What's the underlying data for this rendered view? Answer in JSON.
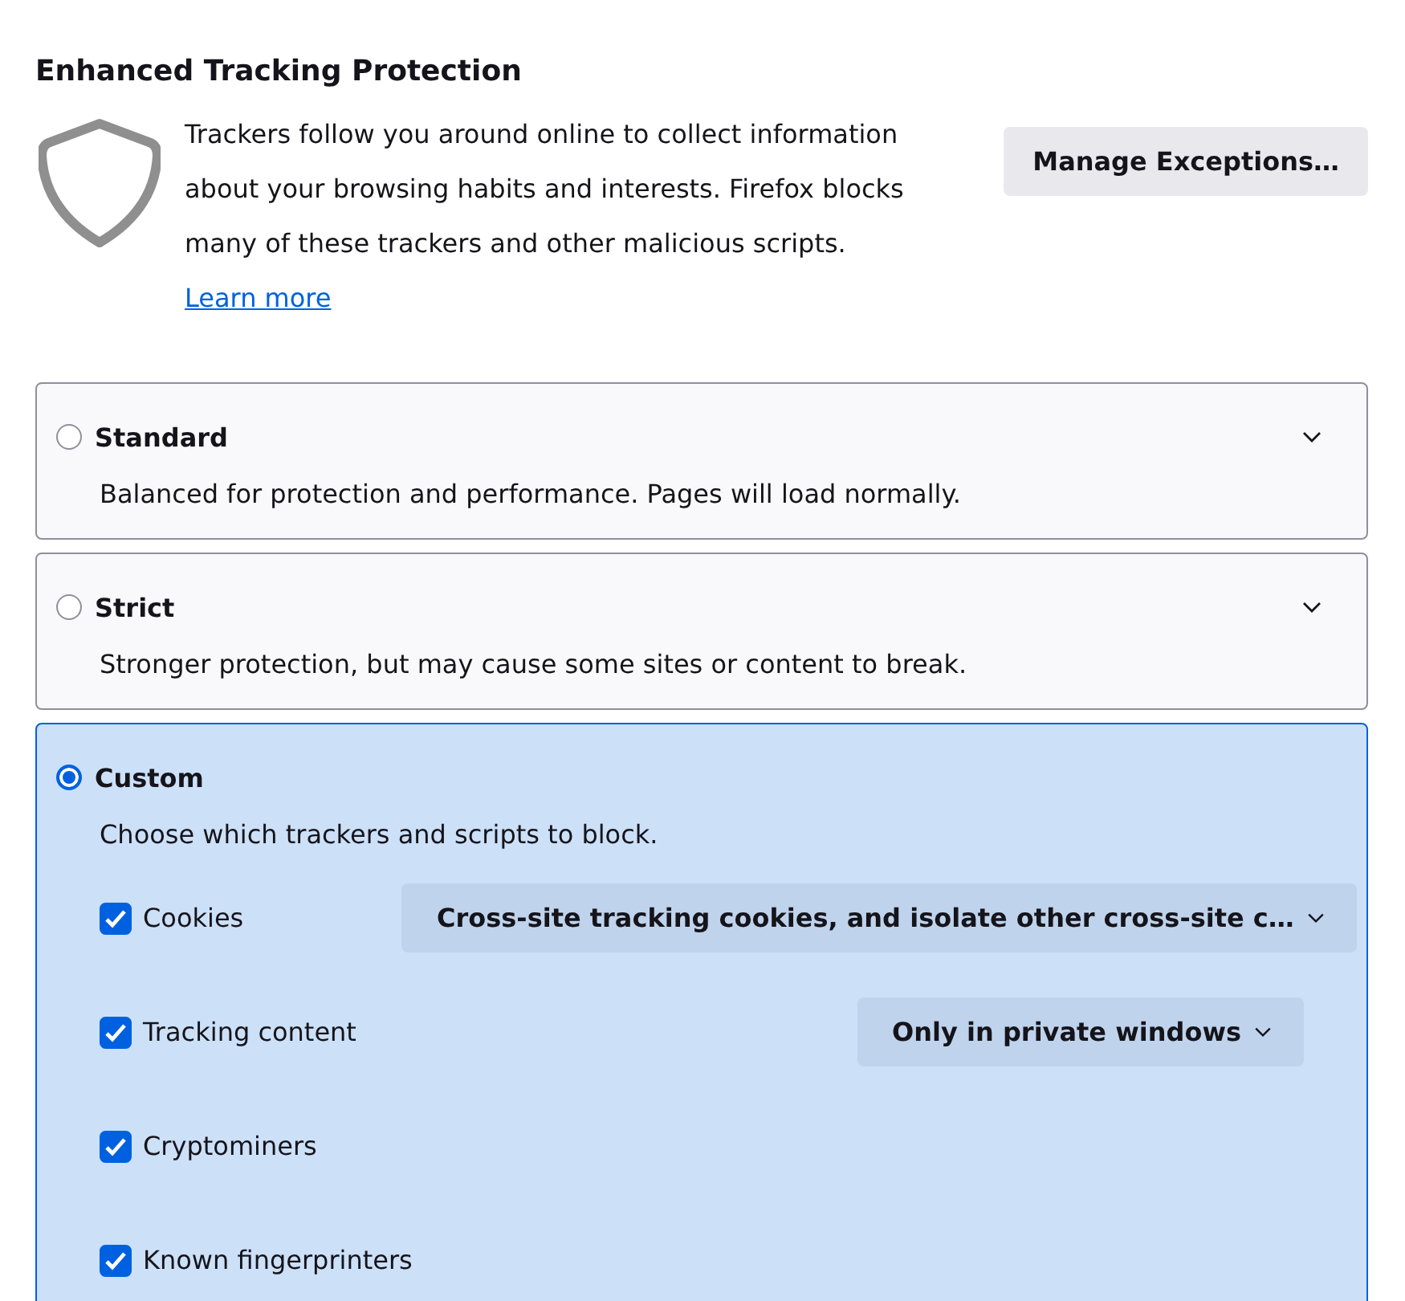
{
  "heading": "Enhanced Tracking Protection",
  "intro": {
    "text": "Trackers follow you around online to collect information about your browsing habits and interests. Firefox blocks many of these trackers and other malicious scripts.",
    "link": "Learn more"
  },
  "manage_button": "Manage Exceptions…",
  "options": [
    {
      "label": "Standard",
      "description": "Balanced for protection and performance. Pages will load normally.",
      "selected": false
    },
    {
      "label": "Strict",
      "description": "Stronger protection, but may cause some sites or content to break.",
      "selected": false
    },
    {
      "label": "Custom",
      "description": "Choose which trackers and scripts to block.",
      "selected": true,
      "items": [
        {
          "label": "Cookies",
          "checked": true,
          "dropdown": "Cross-site tracking cookies, and isolate other cross-site c…"
        },
        {
          "label": "Tracking content",
          "checked": true,
          "dropdown": "Only in private windows"
        },
        {
          "label": "Cryptominers",
          "checked": true
        },
        {
          "label": "Known fingerprinters",
          "checked": true
        }
      ]
    }
  ]
}
